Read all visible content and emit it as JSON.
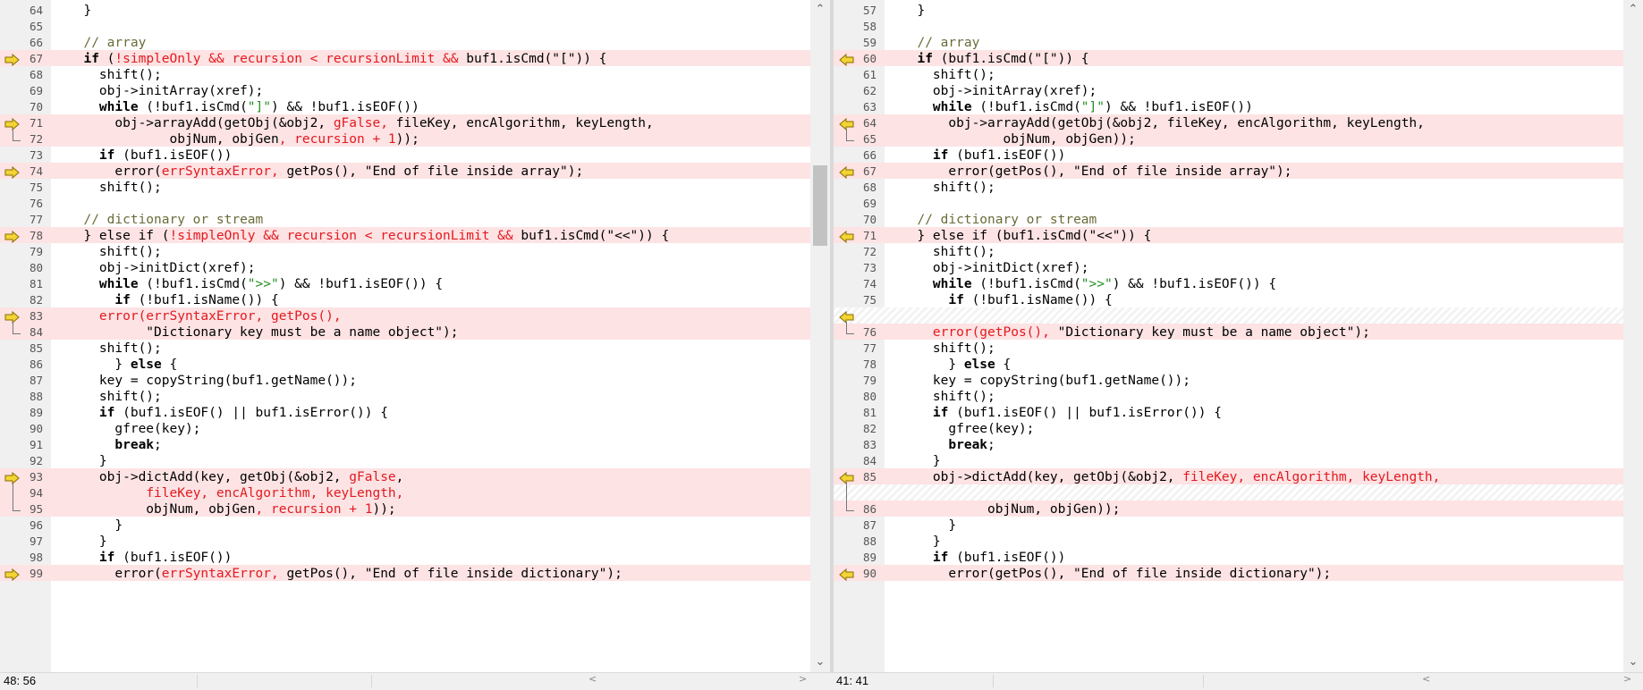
{
  "left": {
    "rows": [
      {
        "num": "64",
        "diff": false,
        "tokens": [
          {
            "t": "  }"
          }
        ]
      },
      {
        "num": "65",
        "diff": false,
        "tokens": []
      },
      {
        "num": "66",
        "diff": false,
        "tokens": [
          {
            "t": "  "
          },
          {
            "t": "// array",
            "c": "cm"
          }
        ]
      },
      {
        "num": "67",
        "diff": true,
        "marker": true,
        "tokens": [
          {
            "t": "  "
          },
          {
            "t": "if",
            "c": "kw"
          },
          {
            "t": " ("
          },
          {
            "t": "!simpleOnly && recursion < recursionLimit &&",
            "c": "hl"
          },
          {
            "t": " buf1.isCmd(\"[\")) {"
          }
        ]
      },
      {
        "num": "68",
        "diff": false,
        "tokens": [
          {
            "t": "    shift();"
          }
        ]
      },
      {
        "num": "69",
        "diff": false,
        "tokens": [
          {
            "t": "    obj->initArray(xref);"
          }
        ]
      },
      {
        "num": "70",
        "diff": false,
        "tokens": [
          {
            "t": "    "
          },
          {
            "t": "while",
            "c": "kw"
          },
          {
            "t": " (!buf1.isCmd("
          },
          {
            "t": "\"]\"",
            "c": "str"
          },
          {
            "t": ") && !buf1.isEOF())"
          }
        ]
      },
      {
        "num": "71",
        "diff": true,
        "marker": true,
        "bracket": "start",
        "tokens": [
          {
            "t": "      obj->arrayAdd(getObj(&obj2, "
          },
          {
            "t": "gFalse,",
            "c": "hl"
          },
          {
            "t": " fileKey, encAlgorithm, keyLength,"
          }
        ]
      },
      {
        "num": "72",
        "diff": true,
        "bracket": "end",
        "tokens": [
          {
            "t": "             objNum, objGen"
          },
          {
            "t": ", recursion + 1",
            "c": "hl"
          },
          {
            "t": "));"
          }
        ]
      },
      {
        "num": "73",
        "diff": false,
        "tokens": [
          {
            "t": "    "
          },
          {
            "t": "if",
            "c": "kw"
          },
          {
            "t": " (buf1.isEOF())"
          }
        ]
      },
      {
        "num": "74",
        "diff": true,
        "marker": true,
        "tokens": [
          {
            "t": "      error("
          },
          {
            "t": "errSyntaxError,",
            "c": "hl"
          },
          {
            "t": " getPos(), \"End of file inside array\");"
          }
        ]
      },
      {
        "num": "75",
        "diff": false,
        "tokens": [
          {
            "t": "    shift();"
          }
        ]
      },
      {
        "num": "76",
        "diff": false,
        "tokens": []
      },
      {
        "num": "77",
        "diff": false,
        "tokens": [
          {
            "t": "  "
          },
          {
            "t": "// dictionary or stream",
            "c": "cm"
          }
        ]
      },
      {
        "num": "78",
        "diff": true,
        "marker": true,
        "tokens": [
          {
            "t": "  } else if ("
          },
          {
            "t": "!simpleOnly && recursion < recursionLimit &&",
            "c": "hl"
          },
          {
            "t": " buf1.isCmd(\"<<\")) {"
          }
        ]
      },
      {
        "num": "79",
        "diff": false,
        "tokens": [
          {
            "t": "    shift();"
          }
        ]
      },
      {
        "num": "80",
        "diff": false,
        "tokens": [
          {
            "t": "    obj->initDict(xref);"
          }
        ]
      },
      {
        "num": "81",
        "diff": false,
        "tokens": [
          {
            "t": "    "
          },
          {
            "t": "while",
            "c": "kw"
          },
          {
            "t": " (!buf1.isCmd("
          },
          {
            "t": "\">>\"",
            "c": "str"
          },
          {
            "t": ") && !buf1.isEOF()) {"
          }
        ]
      },
      {
        "num": "82",
        "diff": false,
        "tokens": [
          {
            "t": "      "
          },
          {
            "t": "if",
            "c": "kw"
          },
          {
            "t": " (!buf1.isName()) {"
          }
        ]
      },
      {
        "num": "83",
        "diff": true,
        "marker": true,
        "bracket": "start",
        "tokens": [
          {
            "t": "    "
          },
          {
            "t": "error(errSyntaxError, getPos(),",
            "c": "hl"
          }
        ]
      },
      {
        "num": "84",
        "diff": true,
        "bracket": "end",
        "tokens": [
          {
            "t": "          \"Dictionary key must be a name object\");"
          }
        ]
      },
      {
        "num": "85",
        "diff": false,
        "tokens": [
          {
            "t": "    shift();"
          }
        ]
      },
      {
        "num": "86",
        "diff": false,
        "tokens": [
          {
            "t": "      } "
          },
          {
            "t": "else",
            "c": "kw"
          },
          {
            "t": " {"
          }
        ]
      },
      {
        "num": "87",
        "diff": false,
        "tokens": [
          {
            "t": "    key = copyString(buf1.getName());"
          }
        ]
      },
      {
        "num": "88",
        "diff": false,
        "tokens": [
          {
            "t": "    shift();"
          }
        ]
      },
      {
        "num": "89",
        "diff": false,
        "tokens": [
          {
            "t": "    "
          },
          {
            "t": "if",
            "c": "kw"
          },
          {
            "t": " (buf1.isEOF() || buf1.isError()) {"
          }
        ]
      },
      {
        "num": "90",
        "diff": false,
        "tokens": [
          {
            "t": "      gfree(key);"
          }
        ]
      },
      {
        "num": "91",
        "diff": false,
        "tokens": [
          {
            "t": "      "
          },
          {
            "t": "break",
            "c": "kw"
          },
          {
            "t": ";"
          }
        ]
      },
      {
        "num": "92",
        "diff": false,
        "tokens": [
          {
            "t": "    }"
          }
        ]
      },
      {
        "num": "93",
        "diff": true,
        "marker": true,
        "bracket": "start",
        "tokens": [
          {
            "t": "    obj->dictAdd(key, getObj(&obj2, "
          },
          {
            "t": "gFalse",
            "c": "hl"
          },
          {
            "t": ","
          }
        ]
      },
      {
        "num": "94",
        "diff": true,
        "bracket": "mid",
        "tokens": [
          {
            "t": "          "
          },
          {
            "t": "fileKey, encAlgorithm, keyLength,",
            "c": "hl"
          }
        ]
      },
      {
        "num": "95",
        "diff": true,
        "bracket": "end",
        "tokens": [
          {
            "t": "          objNum, objGen"
          },
          {
            "t": ", recursion + 1",
            "c": "hl"
          },
          {
            "t": "));"
          }
        ]
      },
      {
        "num": "96",
        "diff": false,
        "tokens": [
          {
            "t": "      }"
          }
        ]
      },
      {
        "num": "97",
        "diff": false,
        "tokens": [
          {
            "t": "    }"
          }
        ]
      },
      {
        "num": "98",
        "diff": false,
        "tokens": [
          {
            "t": "    "
          },
          {
            "t": "if",
            "c": "kw"
          },
          {
            "t": " (buf1.isEOF())"
          }
        ]
      },
      {
        "num": "99",
        "diff": true,
        "marker": true,
        "tokens": [
          {
            "t": "      error("
          },
          {
            "t": "errSyntaxError,",
            "c": "hl"
          },
          {
            "t": " getPos(), \"End of file inside dictionary\");"
          }
        ]
      }
    ],
    "status": "48: 56"
  },
  "right": {
    "rows": [
      {
        "num": "57",
        "diff": false,
        "tokens": [
          {
            "t": "  }"
          }
        ]
      },
      {
        "num": "58",
        "diff": false,
        "tokens": []
      },
      {
        "num": "59",
        "diff": false,
        "tokens": [
          {
            "t": "  "
          },
          {
            "t": "// array",
            "c": "cm"
          }
        ]
      },
      {
        "num": "60",
        "diff": true,
        "marker": true,
        "tokens": [
          {
            "t": "  "
          },
          {
            "t": "if",
            "c": "kw"
          },
          {
            "t": " (buf1.isCmd(\"[\")) {"
          }
        ]
      },
      {
        "num": "61",
        "diff": false,
        "tokens": [
          {
            "t": "    shift();"
          }
        ]
      },
      {
        "num": "62",
        "diff": false,
        "tokens": [
          {
            "t": "    obj->initArray(xref);"
          }
        ]
      },
      {
        "num": "63",
        "diff": false,
        "tokens": [
          {
            "t": "    "
          },
          {
            "t": "while",
            "c": "kw"
          },
          {
            "t": " (!buf1.isCmd("
          },
          {
            "t": "\"]\"",
            "c": "str"
          },
          {
            "t": ") && !buf1.isEOF())"
          }
        ]
      },
      {
        "num": "64",
        "diff": true,
        "marker": true,
        "bracket": "start",
        "tokens": [
          {
            "t": "      obj->arrayAdd(getObj(&obj2, fileKey, encAlgorithm, keyLength,"
          }
        ]
      },
      {
        "num": "65",
        "diff": true,
        "bracket": "end",
        "tokens": [
          {
            "t": "             objNum, objGen));"
          }
        ]
      },
      {
        "num": "66",
        "diff": false,
        "tokens": [
          {
            "t": "    "
          },
          {
            "t": "if",
            "c": "kw"
          },
          {
            "t": " (buf1.isEOF())"
          }
        ]
      },
      {
        "num": "67",
        "diff": true,
        "marker": true,
        "tokens": [
          {
            "t": "      error(getPos(), \"End of file inside array\");"
          }
        ]
      },
      {
        "num": "68",
        "diff": false,
        "tokens": [
          {
            "t": "    shift();"
          }
        ]
      },
      {
        "num": "69",
        "diff": false,
        "tokens": []
      },
      {
        "num": "70",
        "diff": false,
        "tokens": [
          {
            "t": "  "
          },
          {
            "t": "// dictionary or stream",
            "c": "cm"
          }
        ]
      },
      {
        "num": "71",
        "diff": true,
        "marker": true,
        "tokens": [
          {
            "t": "  } else if (buf1.isCmd(\"<<\")) {"
          }
        ]
      },
      {
        "num": "72",
        "diff": false,
        "tokens": [
          {
            "t": "    shift();"
          }
        ]
      },
      {
        "num": "73",
        "diff": false,
        "tokens": [
          {
            "t": "    obj->initDict(xref);"
          }
        ]
      },
      {
        "num": "74",
        "diff": false,
        "tokens": [
          {
            "t": "    "
          },
          {
            "t": "while",
            "c": "kw"
          },
          {
            "t": " (!buf1.isCmd("
          },
          {
            "t": "\">>\"",
            "c": "str"
          },
          {
            "t": ") && !buf1.isEOF()) {"
          }
        ]
      },
      {
        "num": "75",
        "diff": false,
        "tokens": [
          {
            "t": "      "
          },
          {
            "t": "if",
            "c": "kw"
          },
          {
            "t": " (!buf1.isName()) {"
          }
        ]
      },
      {
        "num": "",
        "filler": true,
        "marker": true,
        "bracket": "start",
        "tokens": []
      },
      {
        "num": "76",
        "diff": true,
        "bracket": "end",
        "tokens": [
          {
            "t": "    "
          },
          {
            "t": "error(getPos(),",
            "c": "hl"
          },
          {
            "t": " \"Dictionary key must be a name object\");"
          }
        ]
      },
      {
        "num": "77",
        "diff": false,
        "tokens": [
          {
            "t": "    shift();"
          }
        ]
      },
      {
        "num": "78",
        "diff": false,
        "tokens": [
          {
            "t": "      } "
          },
          {
            "t": "else",
            "c": "kw"
          },
          {
            "t": " {"
          }
        ]
      },
      {
        "num": "79",
        "diff": false,
        "tokens": [
          {
            "t": "    key = copyString(buf1.getName());"
          }
        ]
      },
      {
        "num": "80",
        "diff": false,
        "tokens": [
          {
            "t": "    shift();"
          }
        ]
      },
      {
        "num": "81",
        "diff": false,
        "tokens": [
          {
            "t": "    "
          },
          {
            "t": "if",
            "c": "kw"
          },
          {
            "t": " (buf1.isEOF() || buf1.isError()) {"
          }
        ]
      },
      {
        "num": "82",
        "diff": false,
        "tokens": [
          {
            "t": "      gfree(key);"
          }
        ]
      },
      {
        "num": "83",
        "diff": false,
        "tokens": [
          {
            "t": "      "
          },
          {
            "t": "break",
            "c": "kw"
          },
          {
            "t": ";"
          }
        ]
      },
      {
        "num": "84",
        "diff": false,
        "tokens": [
          {
            "t": "    }"
          }
        ]
      },
      {
        "num": "85",
        "diff": true,
        "marker": true,
        "bracket": "start",
        "tokens": [
          {
            "t": "    obj->dictAdd(key, getObj(&obj2, "
          },
          {
            "t": "fileKey, encAlgorithm, keyLength,",
            "c": "hl"
          }
        ]
      },
      {
        "num": "",
        "filler": true,
        "bracket": "mid",
        "tokens": []
      },
      {
        "num": "86",
        "diff": true,
        "bracket": "end",
        "tokens": [
          {
            "t": "           objNum, objGen));"
          }
        ]
      },
      {
        "num": "87",
        "diff": false,
        "tokens": [
          {
            "t": "      }"
          }
        ]
      },
      {
        "num": "88",
        "diff": false,
        "tokens": [
          {
            "t": "    }"
          }
        ]
      },
      {
        "num": "89",
        "diff": false,
        "tokens": [
          {
            "t": "    "
          },
          {
            "t": "if",
            "c": "kw"
          },
          {
            "t": " (buf1.isEOF())"
          }
        ]
      },
      {
        "num": "90",
        "diff": true,
        "marker": true,
        "tokens": [
          {
            "t": "      error(getPos(), \"End of file inside dictionary\");"
          }
        ]
      }
    ],
    "status": "41: 41"
  },
  "marker_colors": {
    "fill": "#f2d434",
    "stroke": "#8a6d00"
  },
  "icons": {
    "scroll_up": "chevron-up-icon",
    "scroll_down": "chevron-down-icon",
    "diff_marker_left": "arrow-right-icon",
    "diff_marker_right": "arrow-left-icon",
    "hscroll_left": "chevron-left-icon",
    "hscroll_right": "chevron-right-icon"
  }
}
